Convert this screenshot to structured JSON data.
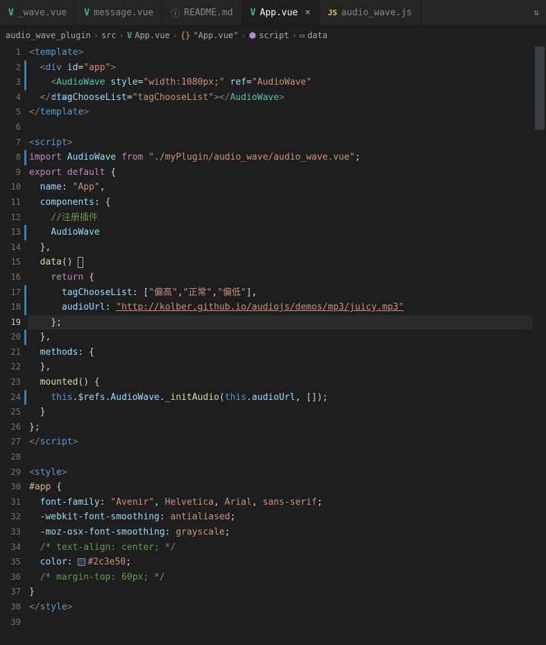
{
  "tabs": [
    {
      "label": "_wave.vue",
      "icon": "vue",
      "active": false,
      "truncated": true
    },
    {
      "label": "message.vue",
      "icon": "vue",
      "active": false
    },
    {
      "label": "README.md",
      "icon": "info",
      "active": false
    },
    {
      "label": "App.vue",
      "icon": "vue",
      "active": true
    },
    {
      "label": "audio_wave.js",
      "icon": "js",
      "active": false
    }
  ],
  "tab_action_icon": "⇅",
  "breadcrumbs": [
    {
      "label": "audio_wave_plugin",
      "icon": null,
      "truncated": true
    },
    {
      "label": "src",
      "icon": null
    },
    {
      "label": "App.vue",
      "icon": "vue"
    },
    {
      "label": "\"App.vue\"",
      "icon": "namespace"
    },
    {
      "label": "script",
      "icon": "script"
    },
    {
      "label": "data",
      "icon": "var"
    }
  ],
  "code": {
    "total_lines": 39,
    "current_line": 19,
    "l1": {
      "tag": "template"
    },
    "l2": {
      "tag": "div",
      "attr": "id",
      "val": "\"app\""
    },
    "l3": {
      "tag": "AudioWave",
      "a1": "style",
      "v1": "\"width:1080px;\"",
      "a2": "ref",
      "v2": "\"AudioWave\"",
      "a3": ":tagChooseList",
      "v3": "\"tagChooseList\"",
      "close": "AudioWave"
    },
    "l4": {
      "close": "div"
    },
    "l5": {
      "close": "template"
    },
    "l7": {
      "tag": "script"
    },
    "l8": {
      "kw1": "import",
      "name": "AudioWave",
      "kw2": "from",
      "path": "\"./myPlugin/audio_wave/audio_wave.vue\""
    },
    "l9": {
      "kw1": "export",
      "kw2": "default"
    },
    "l10": {
      "prop": "name",
      "val": "\"App\""
    },
    "l11": {
      "prop": "components"
    },
    "l12": {
      "comment": "//注册插件"
    },
    "l13": {
      "name": "AudioWave"
    },
    "l15": {
      "fn": "data"
    },
    "l16": {
      "kw": "return"
    },
    "l17": {
      "prop": "tagChooseList",
      "v1": "\"偏高\"",
      "v2": "\"正常\"",
      "v3": "\"偏低\""
    },
    "l18": {
      "prop": "audioUrl",
      "url": "\"http://kolber.github.io/audiojs/demos/mp3/juicy.mp3\""
    },
    "l21": {
      "prop": "methods"
    },
    "l23": {
      "fn": "mounted"
    },
    "l24": {
      "this": "this",
      "refs": "$refs",
      "aw": "AudioWave",
      "init": "_initAudio",
      "au": "audioUrl"
    },
    "l27": {
      "close": "script"
    },
    "l29": {
      "tag": "style"
    },
    "l30": {
      "sel": "#app"
    },
    "l31": {
      "prop": "font-family",
      "v1": "\"Avenir\"",
      "v2": "Helvetica",
      "v3": "Arial",
      "v4": "sans-serif"
    },
    "l32": {
      "prop": "-webkit-font-smoothing",
      "val": "antialiased"
    },
    "l33": {
      "prop": "-moz-osx-font-smoothing",
      "val": "grayscale"
    },
    "l34": {
      "comment": "/* text-align: center; */"
    },
    "l35": {
      "prop": "color",
      "val": "#2c3e50"
    },
    "l36": {
      "comment": "/* margin-top: 60px; */"
    },
    "l38": {
      "close": "style"
    }
  }
}
